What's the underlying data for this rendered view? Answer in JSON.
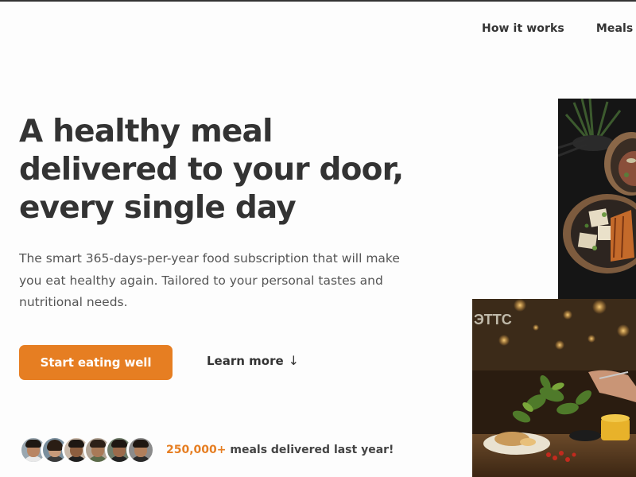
{
  "nav": {
    "items": [
      {
        "label": "How it works"
      },
      {
        "label": "Meals"
      }
    ]
  },
  "hero": {
    "title_lines": [
      "A healthy meal",
      "delivered to your door,",
      "every single day"
    ],
    "description": "The smart 365-days-per-year food subscription that will make you eat healthy again. Tailored to your personal tastes and nutritional needs.",
    "cta_primary": "Start eating well",
    "cta_secondary": "Learn more",
    "cta_secondary_icon": "↓",
    "delivered": {
      "count": "250,000+",
      "text": " meals delivered last year!"
    }
  },
  "colors": {
    "accent": "#e67e22",
    "text": "#333333",
    "muted": "#555555",
    "background": "#fdfdfd"
  },
  "images": {
    "top": "meal-bowls-photo",
    "bottom": "restaurant-dining-photo"
  }
}
